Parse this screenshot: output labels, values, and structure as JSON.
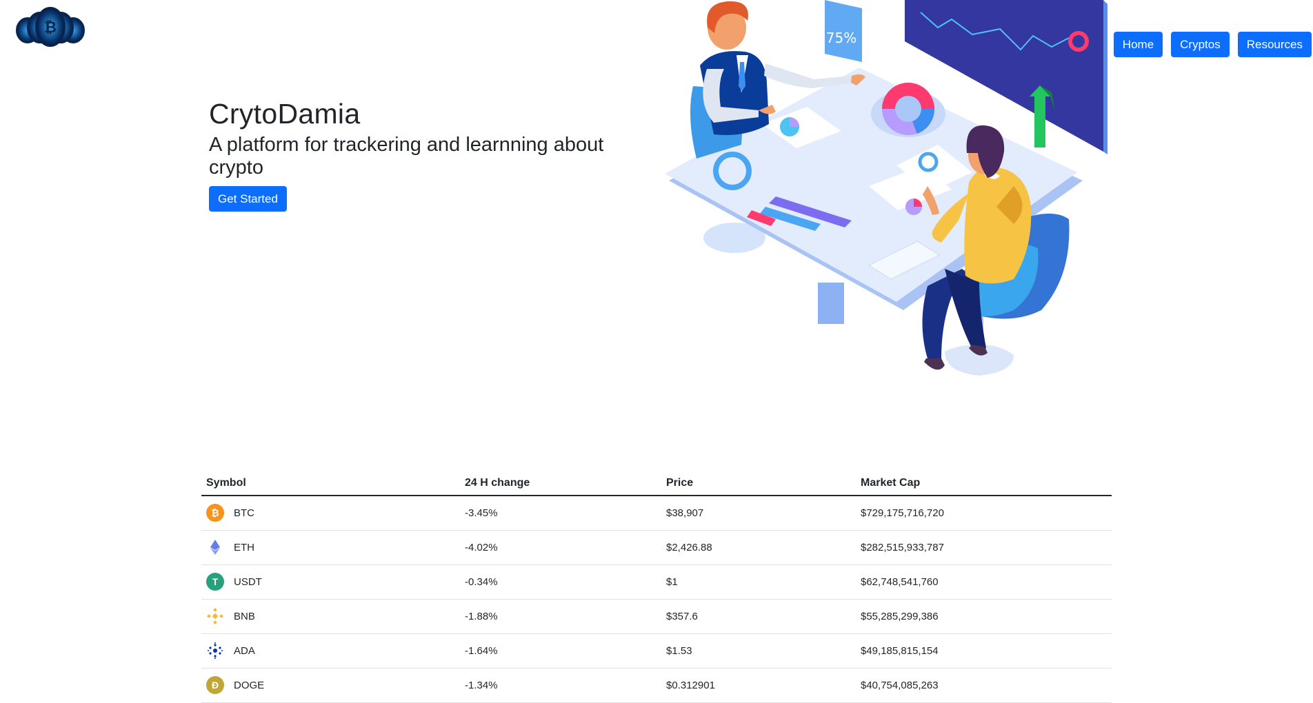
{
  "brand": {
    "title": "CrytoDamia",
    "tagline": "A platform for trackering and learnning about crypto",
    "cta_label": "Get Started"
  },
  "nav": {
    "home": "Home",
    "cryptos": "Cryptos",
    "resources": "Resources"
  },
  "illustration": {
    "badge_text": "75%"
  },
  "table": {
    "headers": [
      "Symbol",
      "24 H change",
      "Price",
      "Market Cap"
    ],
    "rows": [
      {
        "icon": "bitcoin-icon",
        "symbol": "BTC",
        "change": "-3.45%",
        "price": "$38,907",
        "market_cap": "$729,175,716,720"
      },
      {
        "icon": "ethereum-icon",
        "symbol": "ETH",
        "change": "-4.02%",
        "price": "$2,426.88",
        "market_cap": "$282,515,933,787"
      },
      {
        "icon": "tether-icon",
        "symbol": "USDT",
        "change": "-0.34%",
        "price": "$1",
        "market_cap": "$62,748,541,760"
      },
      {
        "icon": "binance-icon",
        "symbol": "BNB",
        "change": "-1.88%",
        "price": "$357.6",
        "market_cap": "$55,285,299,386"
      },
      {
        "icon": "cardano-icon",
        "symbol": "ADA",
        "change": "-1.64%",
        "price": "$1.53",
        "market_cap": "$49,185,815,154"
      },
      {
        "icon": "dogecoin-icon",
        "symbol": "DOGE",
        "change": "-1.34%",
        "price": "$0.312901",
        "market_cap": "$40,754,085,263"
      }
    ]
  },
  "colors": {
    "primary": "#0d6efd",
    "btc": "#f7931a",
    "eth": "#627eea",
    "usdt": "#26a17b",
    "bnb": "#f3ba2f",
    "ada": "#0033ad",
    "doge": "#c2a633"
  }
}
